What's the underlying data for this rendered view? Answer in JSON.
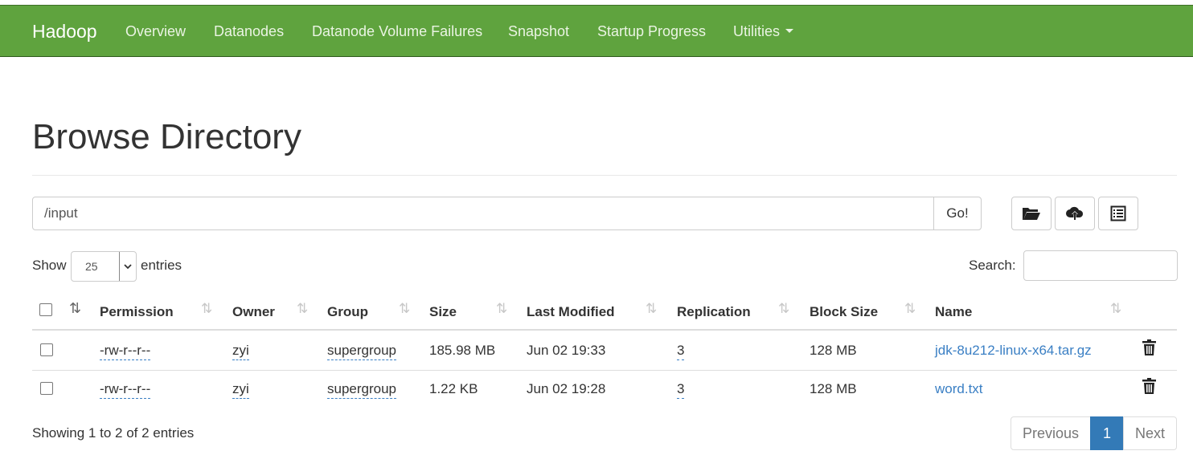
{
  "navbar": {
    "brand": "Hadoop",
    "links": [
      "Overview",
      "Datanodes",
      "Datanode Volume Failures",
      "Snapshot",
      "Startup Progress",
      "Utilities"
    ]
  },
  "page_title": "Browse Directory",
  "path_bar": {
    "value": "/input",
    "go_label": "Go!"
  },
  "toolbar_icons": [
    "folder-open-icon",
    "cloud-upload-icon",
    "list-alt-icon"
  ],
  "controls": {
    "show_label": "Show",
    "page_length": "25",
    "entries_label": "entries",
    "search_label": "Search:"
  },
  "table": {
    "columns": [
      "Permission",
      "Owner",
      "Group",
      "Size",
      "Last Modified",
      "Replication",
      "Block Size",
      "Name"
    ],
    "rows": [
      {
        "permission": "-rw-r--r--",
        "owner": "zyi",
        "group": "supergroup",
        "size": "185.98 MB",
        "modified": "Jun 02 19:33",
        "replication": "3",
        "block_size": "128 MB",
        "name": "jdk-8u212-linux-x64.tar.gz"
      },
      {
        "permission": "-rw-r--r--",
        "owner": "zyi",
        "group": "supergroup",
        "size": "1.22 KB",
        "modified": "Jun 02 19:28",
        "replication": "3",
        "block_size": "128 MB",
        "name": "word.txt"
      }
    ]
  },
  "footer": {
    "info": "Showing 1 to 2 of 2 entries",
    "previous": "Previous",
    "page": "1",
    "next": "Next"
  },
  "colors": {
    "navbar": "#5fa33e",
    "link": "#3a7fc4",
    "active_page": "#337ab7"
  }
}
